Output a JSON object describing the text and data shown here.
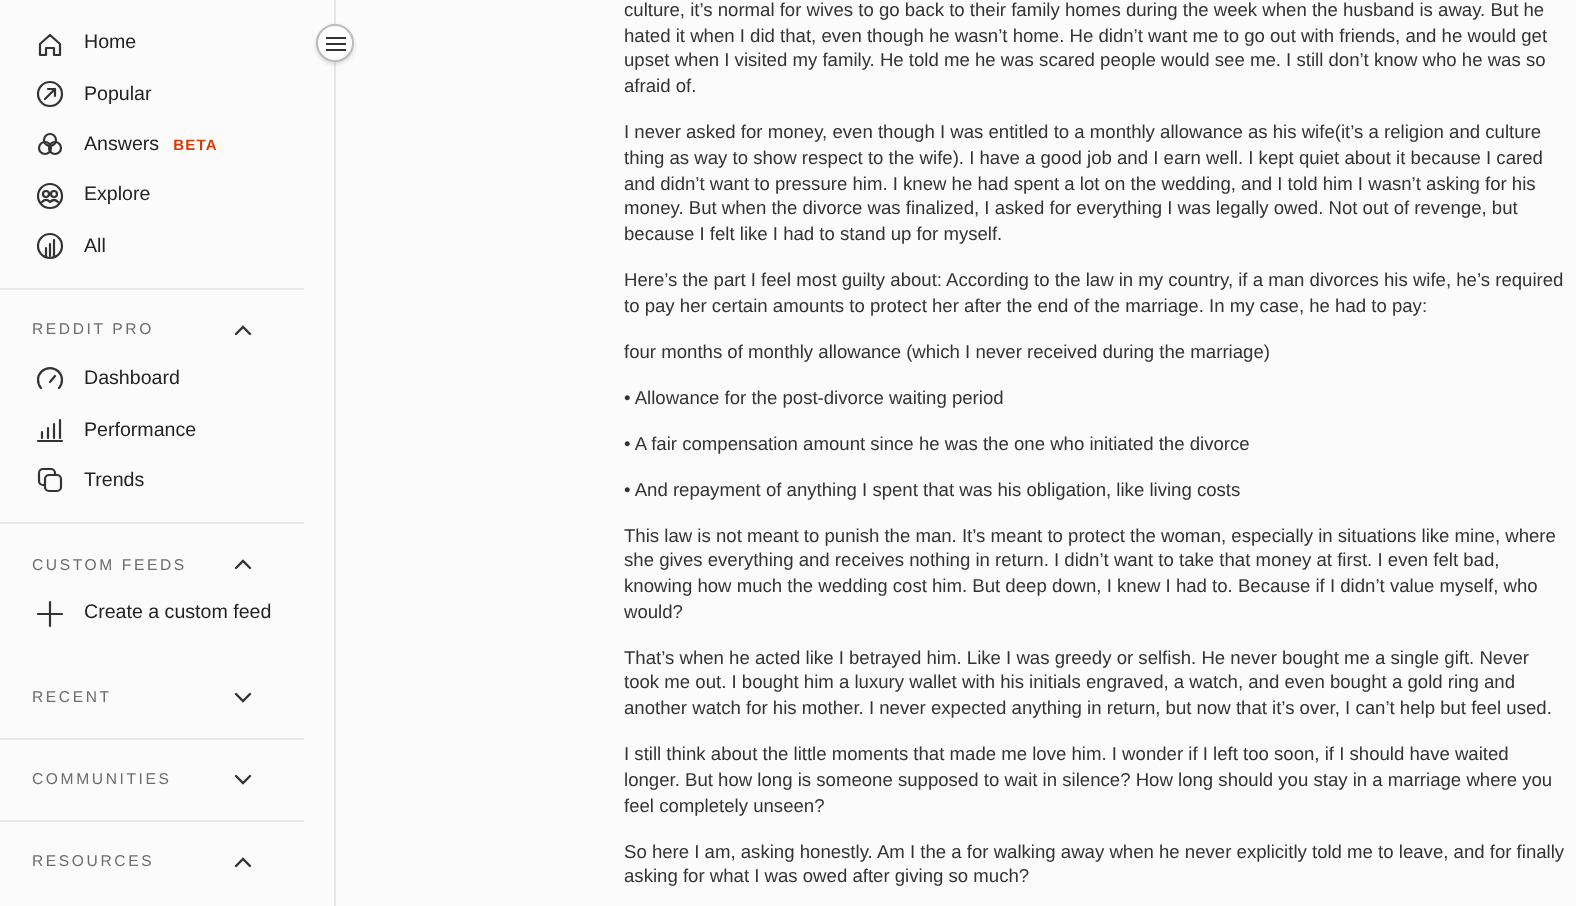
{
  "sidebar": {
    "nav": [
      {
        "kind": "home",
        "label": "Home"
      },
      {
        "kind": "popular",
        "label": "Popular"
      },
      {
        "kind": "answers",
        "label": "Answers",
        "badge": "BETA"
      },
      {
        "kind": "explore",
        "label": "Explore"
      },
      {
        "kind": "all",
        "label": "All"
      }
    ],
    "sections": [
      {
        "title": "REDDIT PRO",
        "expanded": true,
        "items": [
          {
            "kind": "dashboard",
            "label": "Dashboard"
          },
          {
            "kind": "performance",
            "label": "Performance"
          },
          {
            "kind": "trends",
            "label": "Trends"
          }
        ]
      },
      {
        "title": "CUSTOM FEEDS",
        "expanded": true,
        "items": [
          {
            "kind": "plus",
            "label": "Create a custom feed"
          }
        ]
      },
      {
        "title": "RECENT",
        "expanded": false
      },
      {
        "title": "COMMUNITIES",
        "expanded": false
      },
      {
        "title": "RESOURCES",
        "expanded": true
      }
    ]
  },
  "post": {
    "paragraphs": [
      "culture, it’s normal for wives to go back to their family homes during the week when the husband is away. But he hated it when I did that, even though he wasn’t home. He didn’t want me to go out with friends, and he would get upset when I visited my family. He told me he was scared people would see me. I still don’t know who he was so afraid of.",
      "I never asked for money, even though I was entitled to a monthly allowance as his wife(it’s a religion and culture thing as way to show respect to the wife). I have a good job and I earn well. I kept quiet about it because I cared and didn’t want to pressure him. I knew he had spent a lot on the wedding, and I told him I wasn’t asking for his money. But when the divorce was finalized, I asked for everything I was legally owed. Not out of revenge, but because I felt like I had to stand up for myself.",
      "Here’s the part I feel most guilty about: According to the law in my country, if a man divorces his wife, he’s required to pay her certain amounts to protect her after the end of the marriage. In my case, he had to pay:",
      "four months of monthly allowance (which I never received during the marriage)",
      "• Allowance for the post-divorce waiting period",
      "• A fair compensation amount since he was the one who initiated the divorce",
      "• And repayment of anything I spent that was his obligation, like living costs",
      "This law is not meant to punish the man. It’s meant to protect the woman, especially in situations like mine, where she gives everything and receives nothing in return. I didn’t want to take that money at first. I even felt bad, knowing how much the wedding cost him. But deep down, I knew I had to. Because if I didn’t value myself, who would?",
      "That’s when he acted like I betrayed him. Like I was greedy or selfish. He never bought me a single gift. Never took me out. I bought him a luxury wallet with his initials engraved, a watch, and even bought a gold ring and another watch for his mother. I never expected anything in return, but now that it’s over, I can’t help but feel used.",
      "I still think about the little moments that made me love him. I wonder if I left too soon, if I should have waited longer. But how long is someone supposed to wait in silence? How long should you stay in a marriage where you feel completely unseen?",
      "So here I am, asking honestly. Am I the a for walking away when he never explicitly told me to leave, and for finally asking for what I was owed after giving so much?"
    ]
  }
}
